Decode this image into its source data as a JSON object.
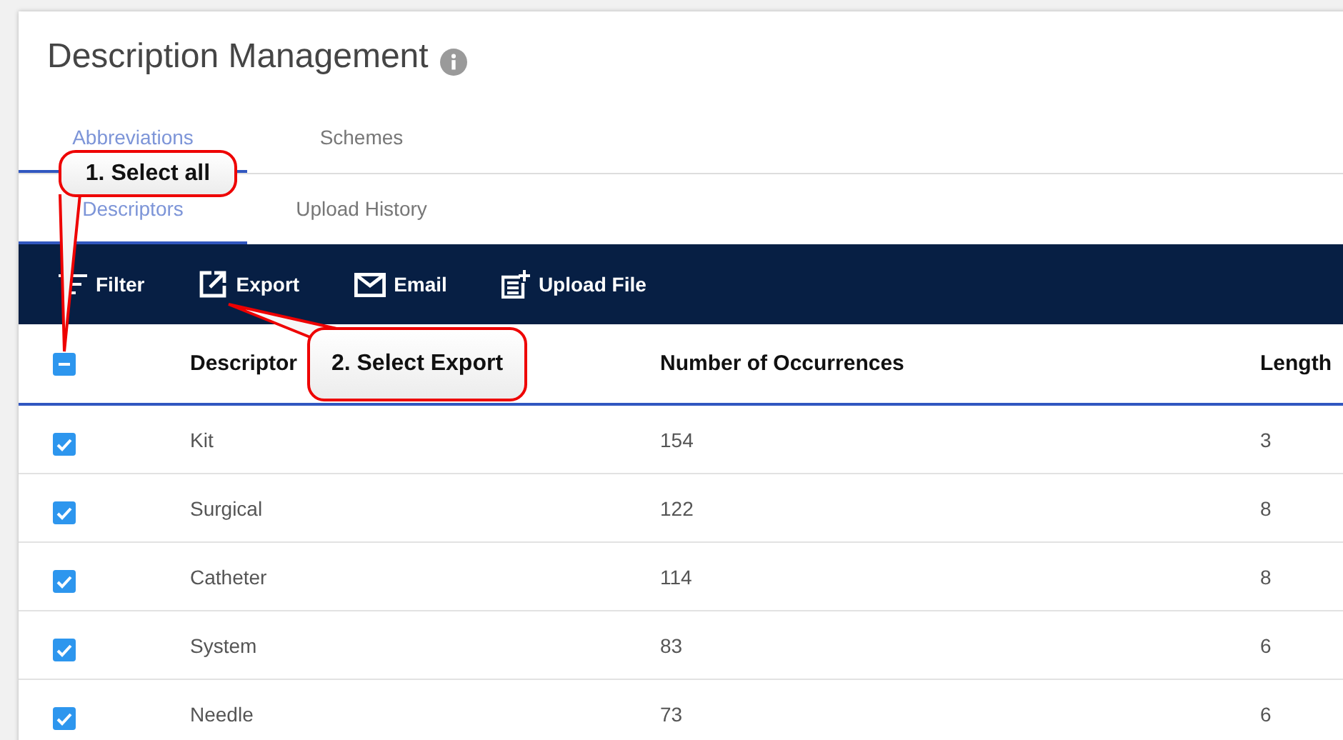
{
  "title": "Description Management",
  "tabs": [
    {
      "label": "Abbreviations",
      "selected": true
    },
    {
      "label": "Schemes",
      "selected": false
    }
  ],
  "subtabs": [
    {
      "label": "Descriptors",
      "selected": true
    },
    {
      "label": "Upload History",
      "selected": false
    }
  ],
  "toolbar": [
    {
      "kind": "filter",
      "label": "Filter"
    },
    {
      "kind": "export",
      "label": "Export"
    },
    {
      "kind": "email",
      "label": "Email"
    },
    {
      "kind": "upload",
      "label": "Upload File"
    }
  ],
  "table": {
    "select_all": {
      "indeterminate": true
    },
    "columns": [
      "Descriptor",
      "Number of Occurrences",
      "Length"
    ],
    "rows": [
      {
        "checked": true,
        "cells": [
          "Kit",
          "154",
          "3"
        ]
      },
      {
        "checked": true,
        "cells": [
          "Surgical",
          "122",
          "8"
        ]
      },
      {
        "checked": true,
        "cells": [
          "Catheter",
          "114",
          "8"
        ]
      },
      {
        "checked": true,
        "cells": [
          "System",
          "83",
          "6"
        ]
      },
      {
        "checked": true,
        "cells": [
          "Needle",
          "73",
          "6"
        ]
      }
    ]
  },
  "callouts": [
    {
      "text": "1. Select all"
    },
    {
      "text": "2. Select Export"
    }
  ]
}
